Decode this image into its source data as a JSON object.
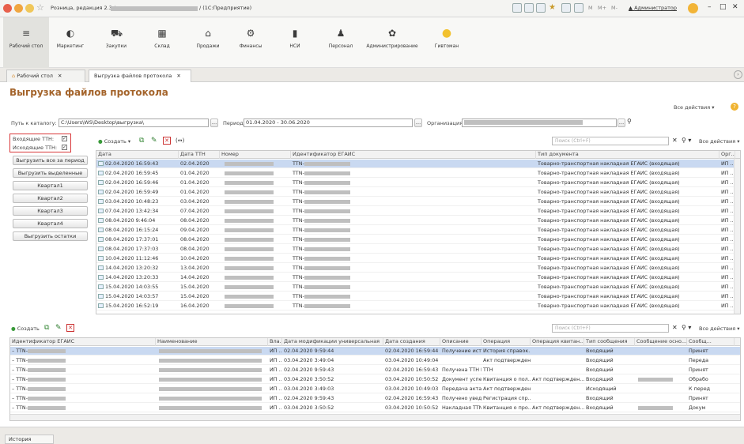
{
  "window": {
    "title": "Розница, редакция 2.3 / / (1С:Предприятие)",
    "title_left": "Розница, редакция 2.3 /",
    "title_right": "/ (1С:Предприятие)",
    "user": "Администратор",
    "mem_buttons": [
      "M",
      "M+",
      "M-"
    ]
  },
  "sections": [
    {
      "label": "Рабочий стол",
      "icon": "≡"
    },
    {
      "label": "Маркетинг",
      "icon": "◐"
    },
    {
      "label": "Закупки",
      "icon": "⛟"
    },
    {
      "label": "Склад",
      "icon": "▦"
    },
    {
      "label": "Продажи",
      "icon": "⌂"
    },
    {
      "label": "Финансы",
      "icon": "⚙"
    },
    {
      "label": "НСИ",
      "icon": "▮"
    },
    {
      "label": "Персонал",
      "icon": "♟"
    },
    {
      "label": "Администрирование",
      "icon": "✿"
    },
    {
      "label": "Гивтоман",
      "icon": "●"
    }
  ],
  "tabs": [
    {
      "label": "Рабочий стол"
    },
    {
      "label": "Выгрузка файлов протокола"
    }
  ],
  "form": {
    "title": "Выгрузка файлов протокола",
    "all_actions": "Все действия",
    "path_label": "Путь к каталогу:",
    "path_value": "C:\\Users\\WS\\Desktop\\выгрузка\\",
    "period_label": "Период:",
    "period_value": "01.04.2020 - 30.06.2020",
    "org_label": "Организация:",
    "incoming_label": "Входящие ТТН:",
    "outgoing_label": "Исходящие ТТН:",
    "check_mark": "✓",
    "left_buttons": [
      "Выгрузить все за период",
      "Выгрузить выделенные",
      "Квартал1",
      "Квартал2",
      "Квартал3",
      "Квартал4",
      "Выгрузить остатки"
    ]
  },
  "top_grid": {
    "create_label": "Создать",
    "search_placeholder": "Поиск (Ctrl+F)",
    "all_actions": "Все действия",
    "columns": [
      "Дата",
      "Дата ТТН",
      "Номер",
      "Идентификатор ЕГАИС",
      "Тип документа",
      "Орг..."
    ],
    "rows": [
      {
        "date": "02.04.2020 16:59:43",
        "ttn_date": "02.04.2020",
        "id": "TTN-",
        "type": "Товарно-транспортная накладная ЕГАИС (входящая)",
        "org": "ИП ..."
      },
      {
        "date": "02.04.2020 16:59:45",
        "ttn_date": "01.04.2020",
        "id": "TTN-",
        "type": "Товарно-транспортная накладная ЕГАИС (входящая)",
        "org": "ИП ..."
      },
      {
        "date": "02.04.2020 16:59:46",
        "ttn_date": "01.04.2020",
        "id": "TTN-",
        "type": "Товарно-транспортная накладная ЕГАИС (входящая)",
        "org": "ИП ..."
      },
      {
        "date": "02.04.2020 16:59:49",
        "ttn_date": "01.04.2020",
        "id": "TTN-",
        "type": "Товарно-транспортная накладная ЕГАИС (входящая)",
        "org": "ИП ..."
      },
      {
        "date": "03.04.2020 10:48:23",
        "ttn_date": "03.04.2020",
        "id": "TTN-",
        "type": "Товарно-транспортная накладная ЕГАИС (входящая)",
        "org": "ИП ..."
      },
      {
        "date": "07.04.2020 13:42:34",
        "ttn_date": "07.04.2020",
        "id": "TTN-",
        "type": "Товарно-транспортная накладная ЕГАИС (входящая)",
        "org": "ИП ..."
      },
      {
        "date": "08.04.2020 9:46:04",
        "ttn_date": "08.04.2020",
        "id": "TTN-",
        "type": "Товарно-транспортная накладная ЕГАИС (входящая)",
        "org": "ИП ..."
      },
      {
        "date": "08.04.2020 16:15:24",
        "ttn_date": "09.04.2020",
        "id": "TTN-",
        "type": "Товарно-транспортная накладная ЕГАИС (входящая)",
        "org": "ИП ..."
      },
      {
        "date": "08.04.2020 17:37:01",
        "ttn_date": "08.04.2020",
        "id": "TTN-",
        "type": "Товарно-транспортная накладная ЕГАИС (входящая)",
        "org": "ИП ..."
      },
      {
        "date": "08.04.2020 17:37:03",
        "ttn_date": "08.04.2020",
        "id": "TTN-",
        "type": "Товарно-транспортная накладная ЕГАИС (входящая)",
        "org": "ИП ..."
      },
      {
        "date": "10.04.2020 11:12:46",
        "ttn_date": "10.04.2020",
        "id": "TTN-",
        "type": "Товарно-транспортная накладная ЕГАИС (входящая)",
        "org": "ИП ..."
      },
      {
        "date": "14.04.2020 13:20:32",
        "ttn_date": "13.04.2020",
        "id": "TTN-",
        "type": "Товарно-транспортная накладная ЕГАИС (входящая)",
        "org": "ИП ..."
      },
      {
        "date": "14.04.2020 13:20:33",
        "ttn_date": "14.04.2020",
        "id": "TTN-",
        "type": "Товарно-транспортная накладная ЕГАИС (входящая)",
        "org": "ИП ..."
      },
      {
        "date": "15.04.2020 14:03:55",
        "ttn_date": "15.04.2020",
        "id": "TTN-",
        "type": "Товарно-транспортная накладная ЕГАИС (входящая)",
        "org": "ИП ..."
      },
      {
        "date": "15.04.2020 14:03:57",
        "ttn_date": "15.04.2020",
        "id": "TTN-",
        "type": "Товарно-транспортная накладная ЕГАИС (входящая)",
        "org": "ИП ..."
      },
      {
        "date": "15.04.2020 16:52:19",
        "ttn_date": "16.04.2020",
        "id": "TTN-",
        "type": "Товарно-транспортная накладная ЕГАИС (входящая)",
        "org": "ИП ..."
      }
    ]
  },
  "bottom_grid": {
    "create_label": "Создать",
    "search_placeholder": "Поиск (Ctrl+F)",
    "all_actions": "Все действия",
    "columns": [
      "Идентификатор ЕГАИС",
      "Наименование",
      "Вла...",
      "Дата модификации универсальная",
      "Дата создания",
      "Описание",
      "Операция",
      "Операция квитан...",
      "Тип сообщения",
      "Сообщение осно...",
      "Сообщ..."
    ],
    "rows": [
      {
        "id": "TTN-",
        "own": "ИП ...",
        "mod": "02.04.2020 9:59:44",
        "created": "02.04.2020 16:59:44",
        "desc": "Получение истор...",
        "op": "История справок...",
        "opq": "",
        "mtype": "Входящий",
        "status": "Принят"
      },
      {
        "id": "TTN-",
        "own": "ИП ...",
        "mod": "03.04.2020 3:49:04",
        "created": "03.04.2020 10:49:04",
        "desc": "",
        "op": "Акт подтвержден...",
        "opq": "",
        "mtype": "Входящий",
        "status": "Переда"
      },
      {
        "id": "TTN-",
        "own": "ИП ...",
        "mod": "02.04.2020 9:59:43",
        "created": "02.04.2020 16:59:43",
        "desc": "Получена ТТН Е...",
        "op": "TTH",
        "opq": "",
        "mtype": "Входящий",
        "status": "Принят"
      },
      {
        "id": "TTN-",
        "own": "ИП ...",
        "mod": "03.04.2020 3:50:52",
        "created": "03.04.2020 10:50:52",
        "desc": "Документ успеш...",
        "op": "Квитанция о пол...",
        "opq": "Акт подтвержден...",
        "mtype": "Входящий",
        "status": "Обрабо"
      },
      {
        "id": "TTN-",
        "own": "ИП ...",
        "mod": "03.04.2020 3:49:03",
        "created": "03.04.2020 10:49:03",
        "desc": "Передача акта п...",
        "op": "Акт подтвержден...",
        "opq": "",
        "mtype": "Исходящий",
        "status": "К перед"
      },
      {
        "id": "TTN-",
        "own": "ИП ...",
        "mod": "02.04.2020 9:59:43",
        "created": "02.04.2020 16:59:43",
        "desc": "Получено уведом...",
        "op": "Регистрация спр...",
        "opq": "",
        "mtype": "Входящий",
        "status": "Принят"
      },
      {
        "id": "TTN-",
        "own": "ИП ...",
        "mod": "03.04.2020 3:50:52",
        "created": "03.04.2020 10:50:52",
        "desc": "Накладная TTN-...",
        "op": "Квитанция о про...",
        "opq": "Акт подтвержден...",
        "mtype": "Входящий",
        "status": "Докум"
      }
    ]
  },
  "footer": {
    "history_label": "История"
  }
}
